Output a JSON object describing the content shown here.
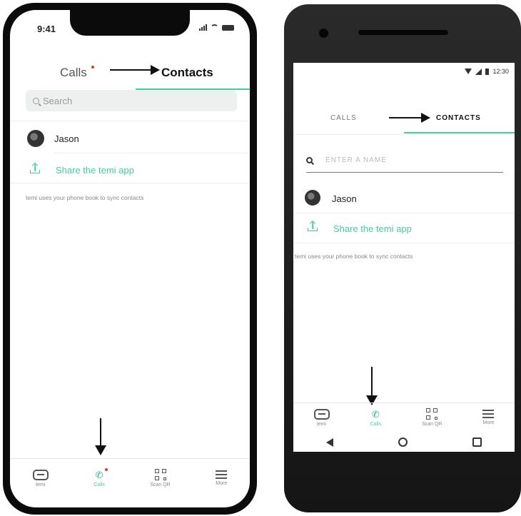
{
  "iphone": {
    "time": "9:41",
    "tabs": {
      "calls": "Calls",
      "contacts": "Contacts"
    },
    "search_placeholder": "Search",
    "contact": {
      "name": "Jason"
    },
    "share": {
      "label": "Share the temi app"
    },
    "hint": "temi uses your phone book to sync contacts",
    "tabbar": [
      {
        "label": "temi",
        "icon": "temi-icon"
      },
      {
        "label": "Calls",
        "icon": "phone-icon"
      },
      {
        "label": "Scan QR",
        "icon": "qr-icon"
      },
      {
        "label": "More",
        "icon": "menu-icon"
      }
    ]
  },
  "android": {
    "time": "12:30",
    "tabs": {
      "calls": "CALLS",
      "contacts": "CONTACTS"
    },
    "search_placeholder": "ENTER A NAME",
    "contact": {
      "name": "Jason"
    },
    "share": {
      "label": "Share the temi app"
    },
    "hint": "temi uses your phone book to sync contacts",
    "tabbar": [
      {
        "label": "temi",
        "icon": "temi-icon"
      },
      {
        "label": "Calls",
        "icon": "phone-icon"
      },
      {
        "label": "Scan QR",
        "icon": "qr-icon"
      },
      {
        "label": "More",
        "icon": "menu-icon"
      }
    ]
  },
  "colors": {
    "accent": "#49c9a1",
    "notification": "#e53935"
  }
}
